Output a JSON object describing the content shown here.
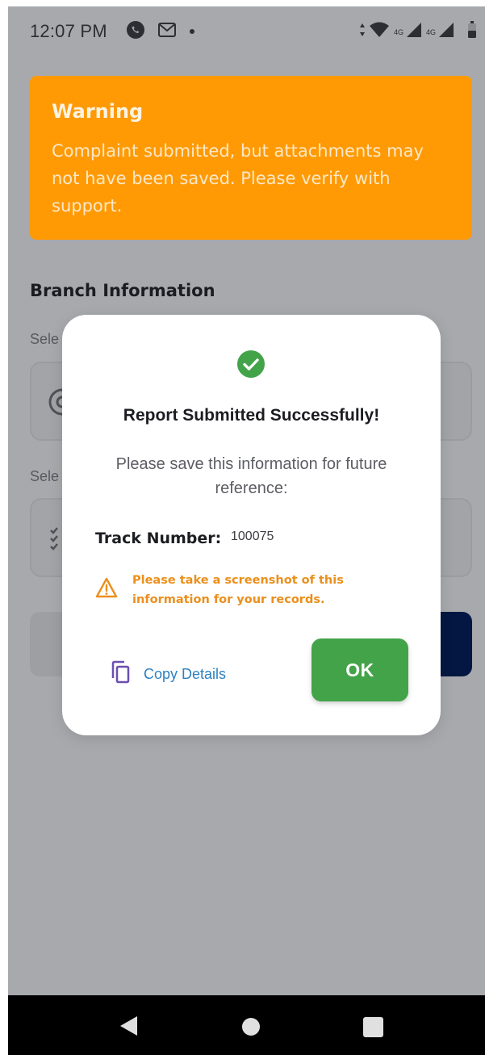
{
  "status_bar": {
    "time": "12:07 PM",
    "network_label_1": "4G",
    "network_label_2": "4G",
    "icons": [
      "whatsapp-icon",
      "gmail-icon",
      "dot-icon",
      "data-arrows-icon",
      "wifi-icon",
      "signal-icon",
      "battery-icon"
    ]
  },
  "warning": {
    "title": "Warning",
    "message": "Complaint submitted, but attachments may not have been saved. Please verify with support.",
    "background_color": "#ff9a05"
  },
  "form": {
    "section_title": "Branch Information",
    "field1_label": "Sele",
    "field2_label": "Sele"
  },
  "dialog": {
    "title": "Report Submitted Successfully!",
    "message": "Please save this information for future reference:",
    "track_label": "Track Number:",
    "track_value": "100075",
    "hint": "Please take a screenshot of this information for your records.",
    "copy_label": "Copy Details",
    "ok_label": "OK",
    "success_color": "#43a349",
    "hint_color": "#eb8f1c",
    "copy_color": "#2d81c0"
  },
  "nav": {
    "icons": [
      "back-icon",
      "home-icon",
      "recents-icon"
    ]
  }
}
